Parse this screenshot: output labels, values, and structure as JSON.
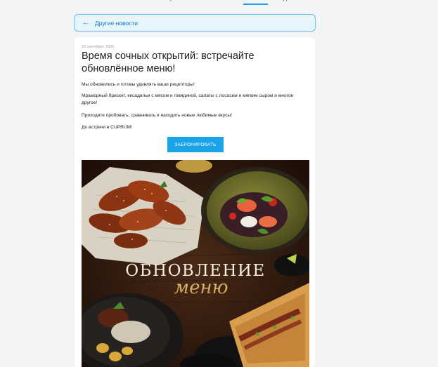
{
  "nav": {
    "items": [
      "О нас",
      "Фотогалерея",
      "Меню",
      "Отзывы",
      "Новости",
      "Видео"
    ],
    "active": "Новости"
  },
  "back": {
    "label": "Другие новости"
  },
  "article": {
    "date": "18 сентября, 2026",
    "title": "Время сочных открытий: встречайте обновлённое меню!",
    "paragraphs": [
      "Мы обновились и готовы удивлять ваши рецепторы!",
      "Мраморный брискет, кесадильи с мясом и говядиной, салаты с лососем и мягким сыром и многое другое!",
      "Приходите пробовать, сравнивать и находить новые любимые вкусы!",
      "До встречи в CUPRUM!"
    ],
    "book_label": "ЗАБРОНИРОВАТЬ"
  },
  "promo": {
    "headline": "ОБНОВЛЕНИЕ",
    "script": "меню"
  },
  "colors": {
    "accent": "#1aa3e8",
    "back_bg": "#e6f4fb",
    "back_border": "#6fbde8"
  }
}
